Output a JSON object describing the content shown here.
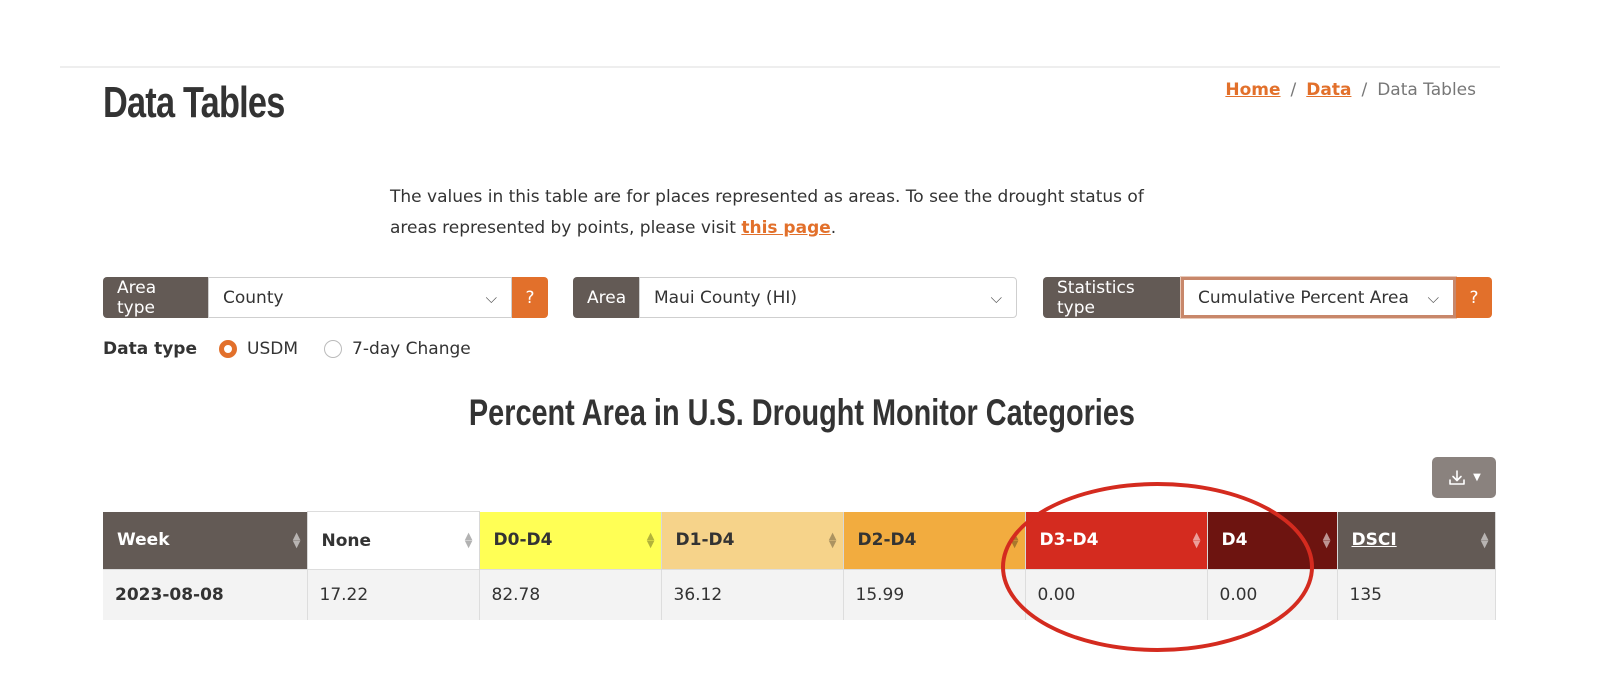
{
  "header": {
    "title": "Data Tables",
    "breadcrumb": [
      {
        "label": "Home",
        "link": true
      },
      {
        "label": "Data",
        "link": true
      },
      {
        "label": "Data Tables",
        "link": false
      }
    ],
    "separator": "/"
  },
  "intro": {
    "text_before": "The values in this table are for places represented as areas. To see the drought status of areas represented by points, please visit ",
    "link_text": "this page",
    "text_after": "."
  },
  "filters": {
    "area_type": {
      "label": "Area type",
      "value": "County",
      "help": "?"
    },
    "area": {
      "label": "Area",
      "value": "Maui County (HI)"
    },
    "statistics_type": {
      "label": "Statistics type",
      "value": "Cumulative Percent Area",
      "help": "?"
    },
    "data_type": {
      "label": "Data type",
      "options": [
        {
          "label": "USDM",
          "checked": true
        },
        {
          "label": "7-day Change",
          "checked": false
        }
      ]
    }
  },
  "table": {
    "title": "Percent Area in U.S. Drought Monitor Categories",
    "download_icon": "download-icon",
    "columns": [
      "Week",
      "None",
      "D0-D4",
      "D1-D4",
      "D2-D4",
      "D3-D4",
      "D4",
      "DSCI"
    ],
    "rows": [
      [
        "2023-08-08",
        "17.22",
        "82.78",
        "36.12",
        "15.99",
        "0.00",
        "0.00",
        "135"
      ]
    ],
    "colors": {
      "week": "#635a55",
      "none": "#ffffff",
      "d0": "#ffff55",
      "d1": "#f6d38a",
      "d2": "#f2ac3f",
      "d3": "#d42b1f",
      "d4": "#6d1410",
      "dsci": "#635a55"
    }
  },
  "accent": "#e2702b",
  "annotation_color": "#d42b1f"
}
